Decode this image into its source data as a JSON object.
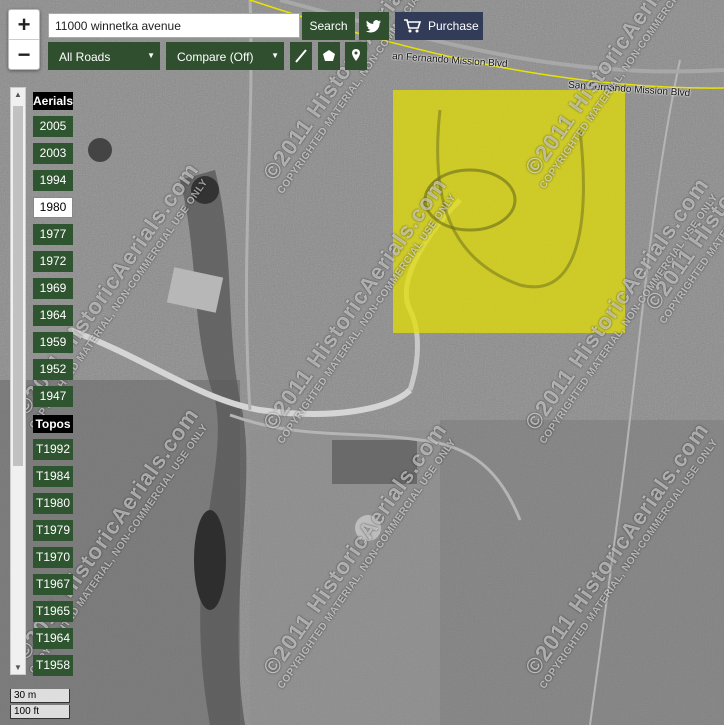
{
  "search": {
    "value": "11000 winnetka avenue",
    "button": "Search"
  },
  "toolbar": {
    "purchase": "Purchase",
    "roads": "All Roads",
    "compare": "Compare (Off)"
  },
  "zoom": {
    "in": "+",
    "out": "−"
  },
  "aerials": {
    "label": "Aerials",
    "years": [
      "2005",
      "2003",
      "1994",
      "1980",
      "1977",
      "1972",
      "1969",
      "1964",
      "1959",
      "1952",
      "1947"
    ],
    "selected": "1980"
  },
  "topos": {
    "label": "Topos",
    "years": [
      "T1992",
      "T1984",
      "T1980",
      "T1979",
      "T1970",
      "T1967",
      "T1965",
      "T1964",
      "T1958"
    ]
  },
  "scale": {
    "metric": "30 m",
    "imperial": "100 ft"
  },
  "map": {
    "roads": [
      "San Fernando Mission Blvd",
      "an Fernando Mission Blvd"
    ],
    "watermark_main": "©2011 HistoricAerials.com",
    "watermark_sub": "COPYRIGHTED MATERIAL, NON-COMMERCIAL USE ONLY"
  },
  "colors": {
    "highlight": "#e5e000",
    "button_green": "#2f5530",
    "purchase_blue": "#323c58"
  }
}
